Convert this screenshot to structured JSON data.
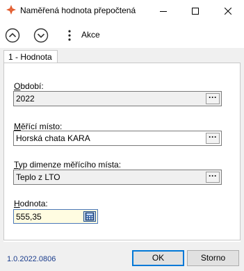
{
  "window": {
    "title": "Naměřená hodnota přepočtená",
    "icon": "app-logo-icon",
    "controls": [
      "minimize-icon",
      "maximize-icon",
      "close-icon"
    ]
  },
  "toolbar": {
    "prev_icon": "chevron-up-circle-icon",
    "next_icon": "chevron-down-circle-icon",
    "menu_icon": "vertical-dots-icon",
    "actions_label": "Akce"
  },
  "tabs": [
    {
      "label": "1 - Hodnota",
      "selected": true
    }
  ],
  "form": {
    "obdobi": {
      "label_key": "O",
      "label_rest": "bdobí:",
      "value": "2022"
    },
    "merici_misto": {
      "label_key": "M",
      "label_rest": "ěřící místo:",
      "value": "Horská chata KARA"
    },
    "typ_dimenze": {
      "label_key": "T",
      "label_rest": "yp dimenze měřícího místa:",
      "value": "Teplo z LTO"
    },
    "hodnota": {
      "label_key": "H",
      "label_rest": "odnota:",
      "value": "555,35"
    },
    "lookup_label": "···"
  },
  "footer": {
    "version": "1.0.2022.0806",
    "ok_label": "OK",
    "cancel_label": "Storno"
  },
  "colors": {
    "accent": "#0078d7",
    "version_text": "#1a3c8c",
    "highlight_field": "#fffce1",
    "app_icon": "#e25c2e"
  }
}
